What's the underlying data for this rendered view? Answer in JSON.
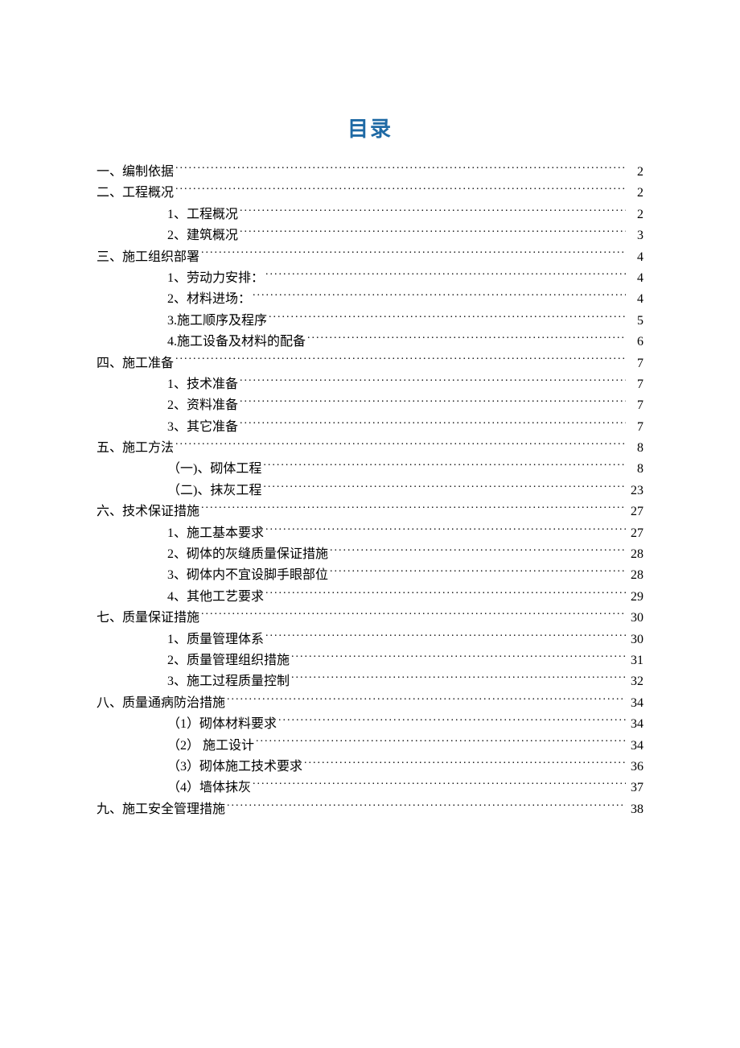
{
  "title": "目录",
  "entries": [
    {
      "level": 1,
      "label": "一、编制依据",
      "page": "2"
    },
    {
      "level": 1,
      "label": "二、工程概况",
      "page": "2"
    },
    {
      "level": 2,
      "label": "1、工程概况",
      "page": "2"
    },
    {
      "level": 2,
      "label": "2、建筑概况",
      "page": "3"
    },
    {
      "level": 1,
      "label": "三、施工组织部署",
      "page": "4"
    },
    {
      "level": 2,
      "label": "1、劳动力安排：",
      "page": "4"
    },
    {
      "level": 2,
      "label": "2、材料进场：",
      "page": "4"
    },
    {
      "level": 2,
      "label": "3.施工顺序及程序",
      "page": "5"
    },
    {
      "level": 2,
      "label": "4.施工设备及材料的配备",
      "page": "6"
    },
    {
      "level": 1,
      "label": "四、施工准备",
      "page": "7"
    },
    {
      "level": 2,
      "label": "1、技术准备",
      "page": "7"
    },
    {
      "level": 2,
      "label": "2、资料准备",
      "page": "7"
    },
    {
      "level": 2,
      "label": "3、其它准备",
      "page": "7"
    },
    {
      "level": 1,
      "label": "五、施工方法",
      "page": "8"
    },
    {
      "level": 2,
      "label": "（一)、砌体工程",
      "page": "8"
    },
    {
      "level": 2,
      "label": "（二)、抹灰工程",
      "page": "23"
    },
    {
      "level": 1,
      "label": "六、技术保证措施",
      "page": "27"
    },
    {
      "level": 2,
      "label": "1、施工基本要求",
      "page": "27"
    },
    {
      "level": 2,
      "label": "2、砌体的灰缝质量保证措施",
      "page": "28"
    },
    {
      "level": 2,
      "label": "3、砌体内不宜设脚手眼部位",
      "page": "28"
    },
    {
      "level": 2,
      "label": "4、其他工艺要求",
      "page": "29"
    },
    {
      "level": 1,
      "label": "七、质量保证措施",
      "page": "30"
    },
    {
      "level": 2,
      "label": "1、质量管理体系",
      "page": "30"
    },
    {
      "level": 2,
      "label": "2、质量管理组织措施",
      "page": "31"
    },
    {
      "level": 2,
      "label": "3、施工过程质量控制",
      "page": "32"
    },
    {
      "level": 1,
      "label": "八、质量通病防治措施",
      "page": "34"
    },
    {
      "level": 2,
      "label": "（1）砌体材料要求",
      "page": "34"
    },
    {
      "level": 2,
      "label": "（2）  施工设计",
      "page": "34"
    },
    {
      "level": 2,
      "label": "（3）砌体施工技术要求",
      "page": "36"
    },
    {
      "level": 2,
      "label": "（4）墙体抹灰",
      "page": "37"
    },
    {
      "level": 1,
      "label": "九、施工安全管理措施",
      "page": "38"
    }
  ]
}
